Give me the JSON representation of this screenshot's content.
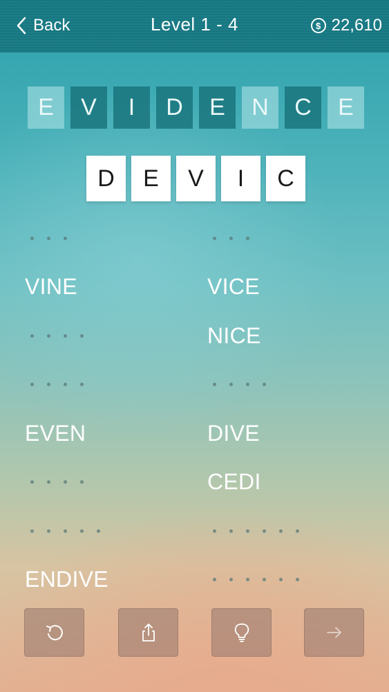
{
  "header": {
    "back_label": "Back",
    "title": "Level 1 - 4",
    "coins": "22,610"
  },
  "source_word": [
    {
      "letter": "E",
      "used": false
    },
    {
      "letter": "V",
      "used": true
    },
    {
      "letter": "I",
      "used": true
    },
    {
      "letter": "D",
      "used": true
    },
    {
      "letter": "E",
      "used": true
    },
    {
      "letter": "N",
      "used": false
    },
    {
      "letter": "C",
      "used": true
    },
    {
      "letter": "E",
      "used": false
    }
  ],
  "guess": [
    "D",
    "E",
    "V",
    "I",
    "C"
  ],
  "words": {
    "left": [
      {
        "text": "",
        "length": 3
      },
      {
        "text": "VINE",
        "length": 4
      },
      {
        "text": "",
        "length": 4
      },
      {
        "text": "",
        "length": 4
      },
      {
        "text": "EVEN",
        "length": 4
      },
      {
        "text": "",
        "length": 4
      },
      {
        "text": "",
        "length": 5
      },
      {
        "text": "ENDIVE",
        "length": 6
      }
    ],
    "right": [
      {
        "text": "",
        "length": 3
      },
      {
        "text": "VICE",
        "length": 4
      },
      {
        "text": "NICE",
        "length": 4
      },
      {
        "text": "",
        "length": 4
      },
      {
        "text": "DIVE",
        "length": 4
      },
      {
        "text": "CEDI",
        "length": 4
      },
      {
        "text": "",
        "length": 6
      },
      {
        "text": "",
        "length": 6
      }
    ]
  },
  "buttons": [
    {
      "name": "undo-button",
      "icon": "undo-icon"
    },
    {
      "name": "share-button",
      "icon": "share-icon"
    },
    {
      "name": "hint-button",
      "icon": "lightbulb-icon"
    },
    {
      "name": "next-button",
      "icon": "arrow-right-icon"
    }
  ],
  "colors": {
    "header": "#1f7a82",
    "tile_used": "#146e76",
    "tile_free": "#aae1e4",
    "button": "#96786e"
  }
}
